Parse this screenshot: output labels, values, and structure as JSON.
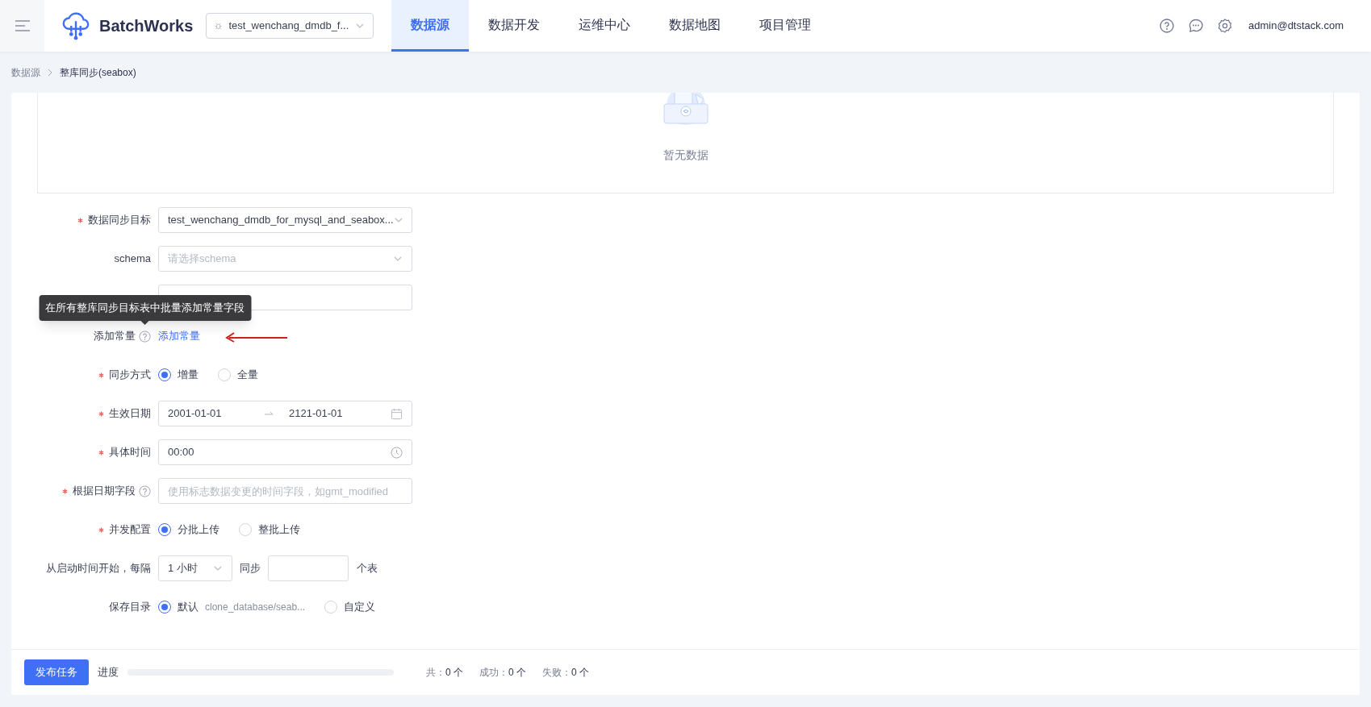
{
  "header": {
    "app_name": "BatchWorks",
    "project": "test_wenchang_dmdb_f...",
    "nav": [
      {
        "label": "数据源",
        "selected": true
      },
      {
        "label": "数据开发",
        "selected": false
      },
      {
        "label": "运维中心",
        "selected": false
      },
      {
        "label": "数据地图",
        "selected": false
      },
      {
        "label": "项目管理",
        "selected": false
      }
    ],
    "user": "admin@dtstack.com"
  },
  "breadcrumb": [
    "数据源",
    "整库同步(seabox)"
  ],
  "empty_state": {
    "text": "暂无数据"
  },
  "form": {
    "fields": [
      {
        "kind": "select",
        "label": "数据同步目标",
        "required": true,
        "value": "test_wenchang_dmdb_for_mysql_and_seabox..."
      },
      {
        "kind": "select",
        "label": "schema",
        "required": false,
        "placeholder": "请选择schema"
      },
      {
        "kind": "input"
      },
      {
        "kind": "link",
        "label": "添加常量",
        "help": true,
        "link": "添加常量",
        "tooltip": "在所有整库同步目标表中批量添加常量字段"
      },
      {
        "kind": "radio",
        "label": "同步方式",
        "required": true,
        "options": [
          {
            "label": "增量",
            "selected": true
          },
          {
            "label": "全量",
            "selected": false
          }
        ]
      },
      {
        "kind": "daterange",
        "label": "生效日期",
        "required": true,
        "start": "2001-01-01",
        "end": "2121-01-01"
      },
      {
        "kind": "time",
        "label": "具体时间",
        "required": true,
        "value": "00:00"
      },
      {
        "kind": "input",
        "label": "根据日期字段",
        "required": true,
        "help": true,
        "placeholder": "使用标志数据变更的时间字段，如gmt_modified"
      },
      {
        "kind": "radio",
        "label": "并发配置",
        "required": true,
        "options": [
          {
            "label": "分批上传",
            "selected": true
          },
          {
            "label": "整批上传",
            "selected": false
          }
        ]
      },
      {
        "kind": "interval",
        "label": "从启动时间开始，每隔",
        "value": "1 小时",
        "middle": "同步",
        "suffix": "个表"
      },
      {
        "kind": "radio",
        "label": "保存目录",
        "required": false,
        "options": [
          {
            "label": "默认",
            "detail": "clone_database/seab...",
            "selected": true
          },
          {
            "label": "自定义",
            "selected": false
          }
        ]
      }
    ]
  },
  "footer": {
    "button": "发布任务",
    "progress_label": "进度",
    "level": 0,
    "stats": [
      {
        "label": "共：",
        "value": "0 个"
      },
      {
        "label": "成功：",
        "value": "0 个"
      },
      {
        "label": "失败：",
        "value": "0 个"
      }
    ]
  }
}
